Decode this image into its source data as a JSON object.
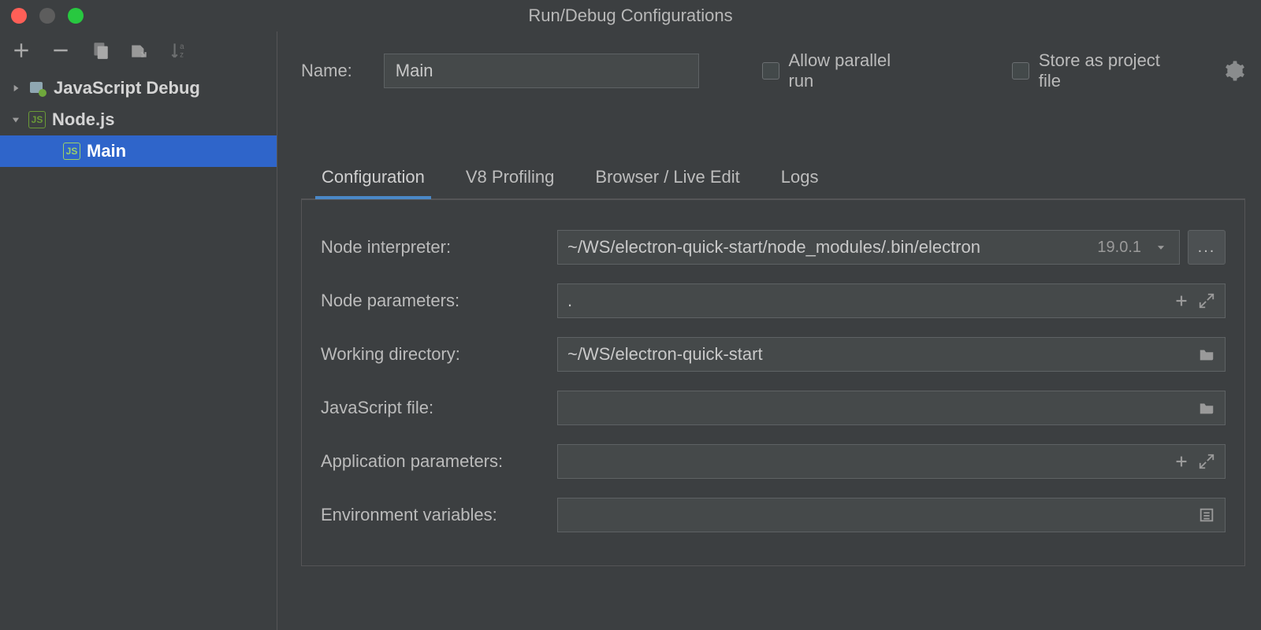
{
  "window": {
    "title": "Run/Debug Configurations"
  },
  "sidebar": {
    "tree": [
      {
        "label": "JavaScript Debug"
      },
      {
        "label": "Node.js"
      },
      {
        "label": "Main"
      }
    ]
  },
  "name": {
    "label": "Name:",
    "value": "Main"
  },
  "checks": {
    "parallel": "Allow parallel run",
    "store": "Store as project file"
  },
  "tabs": {
    "t0": "Configuration",
    "t1": "V8 Profiling",
    "t2": "Browser / Live Edit",
    "t3": "Logs"
  },
  "form": {
    "interpreter": {
      "label": "Node interpreter:",
      "value": "~/WS/electron-quick-start/node_modules/.bin/electron",
      "version": "19.0.1"
    },
    "nodeparams": {
      "label": "Node parameters:",
      "value": "."
    },
    "workdir": {
      "label": "Working directory:",
      "value": "~/WS/electron-quick-start"
    },
    "jsfile": {
      "label": "JavaScript file:",
      "value": ""
    },
    "appparams": {
      "label": "Application parameters:",
      "value": ""
    },
    "envvars": {
      "label": "Environment variables:",
      "value": ""
    },
    "browse": "..."
  }
}
